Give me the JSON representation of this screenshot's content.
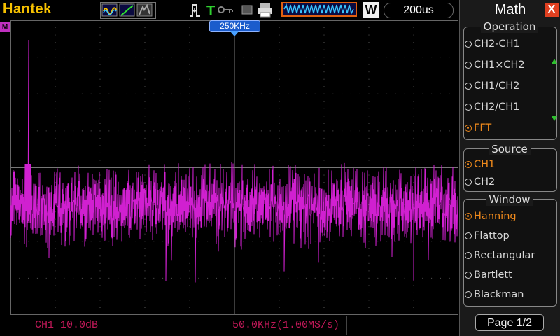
{
  "header": {
    "brand": "Hantek",
    "trigger_mode_letter": "T",
    "timebase_badge": "W",
    "timebase": "200us"
  },
  "waveform": {
    "channel_marker": "M",
    "fft_center_label": "250KHz",
    "trace_color": "#d020d0",
    "grid_color": "#5a5a5a"
  },
  "status": {
    "ch1_scale": "CH1 10.0dB",
    "freq_scale": "50.0KHz(1.00MS/s)"
  },
  "menu": {
    "title": "Math",
    "close": "X",
    "operation": {
      "title": "Operation",
      "options": [
        "CH2-CH1",
        "CH1×CH2",
        "CH1/CH2",
        "CH2/CH1",
        "FFT"
      ],
      "selected": "FFT"
    },
    "source": {
      "title": "Source",
      "options": [
        "CH1",
        "CH2"
      ],
      "selected": "CH1"
    },
    "window": {
      "title": "Window",
      "options": [
        "Hanning",
        "Flattop",
        "Rectangular",
        "Bartlett",
        "Blackman"
      ],
      "selected": "Hanning"
    },
    "page": "Page 1/2"
  }
}
